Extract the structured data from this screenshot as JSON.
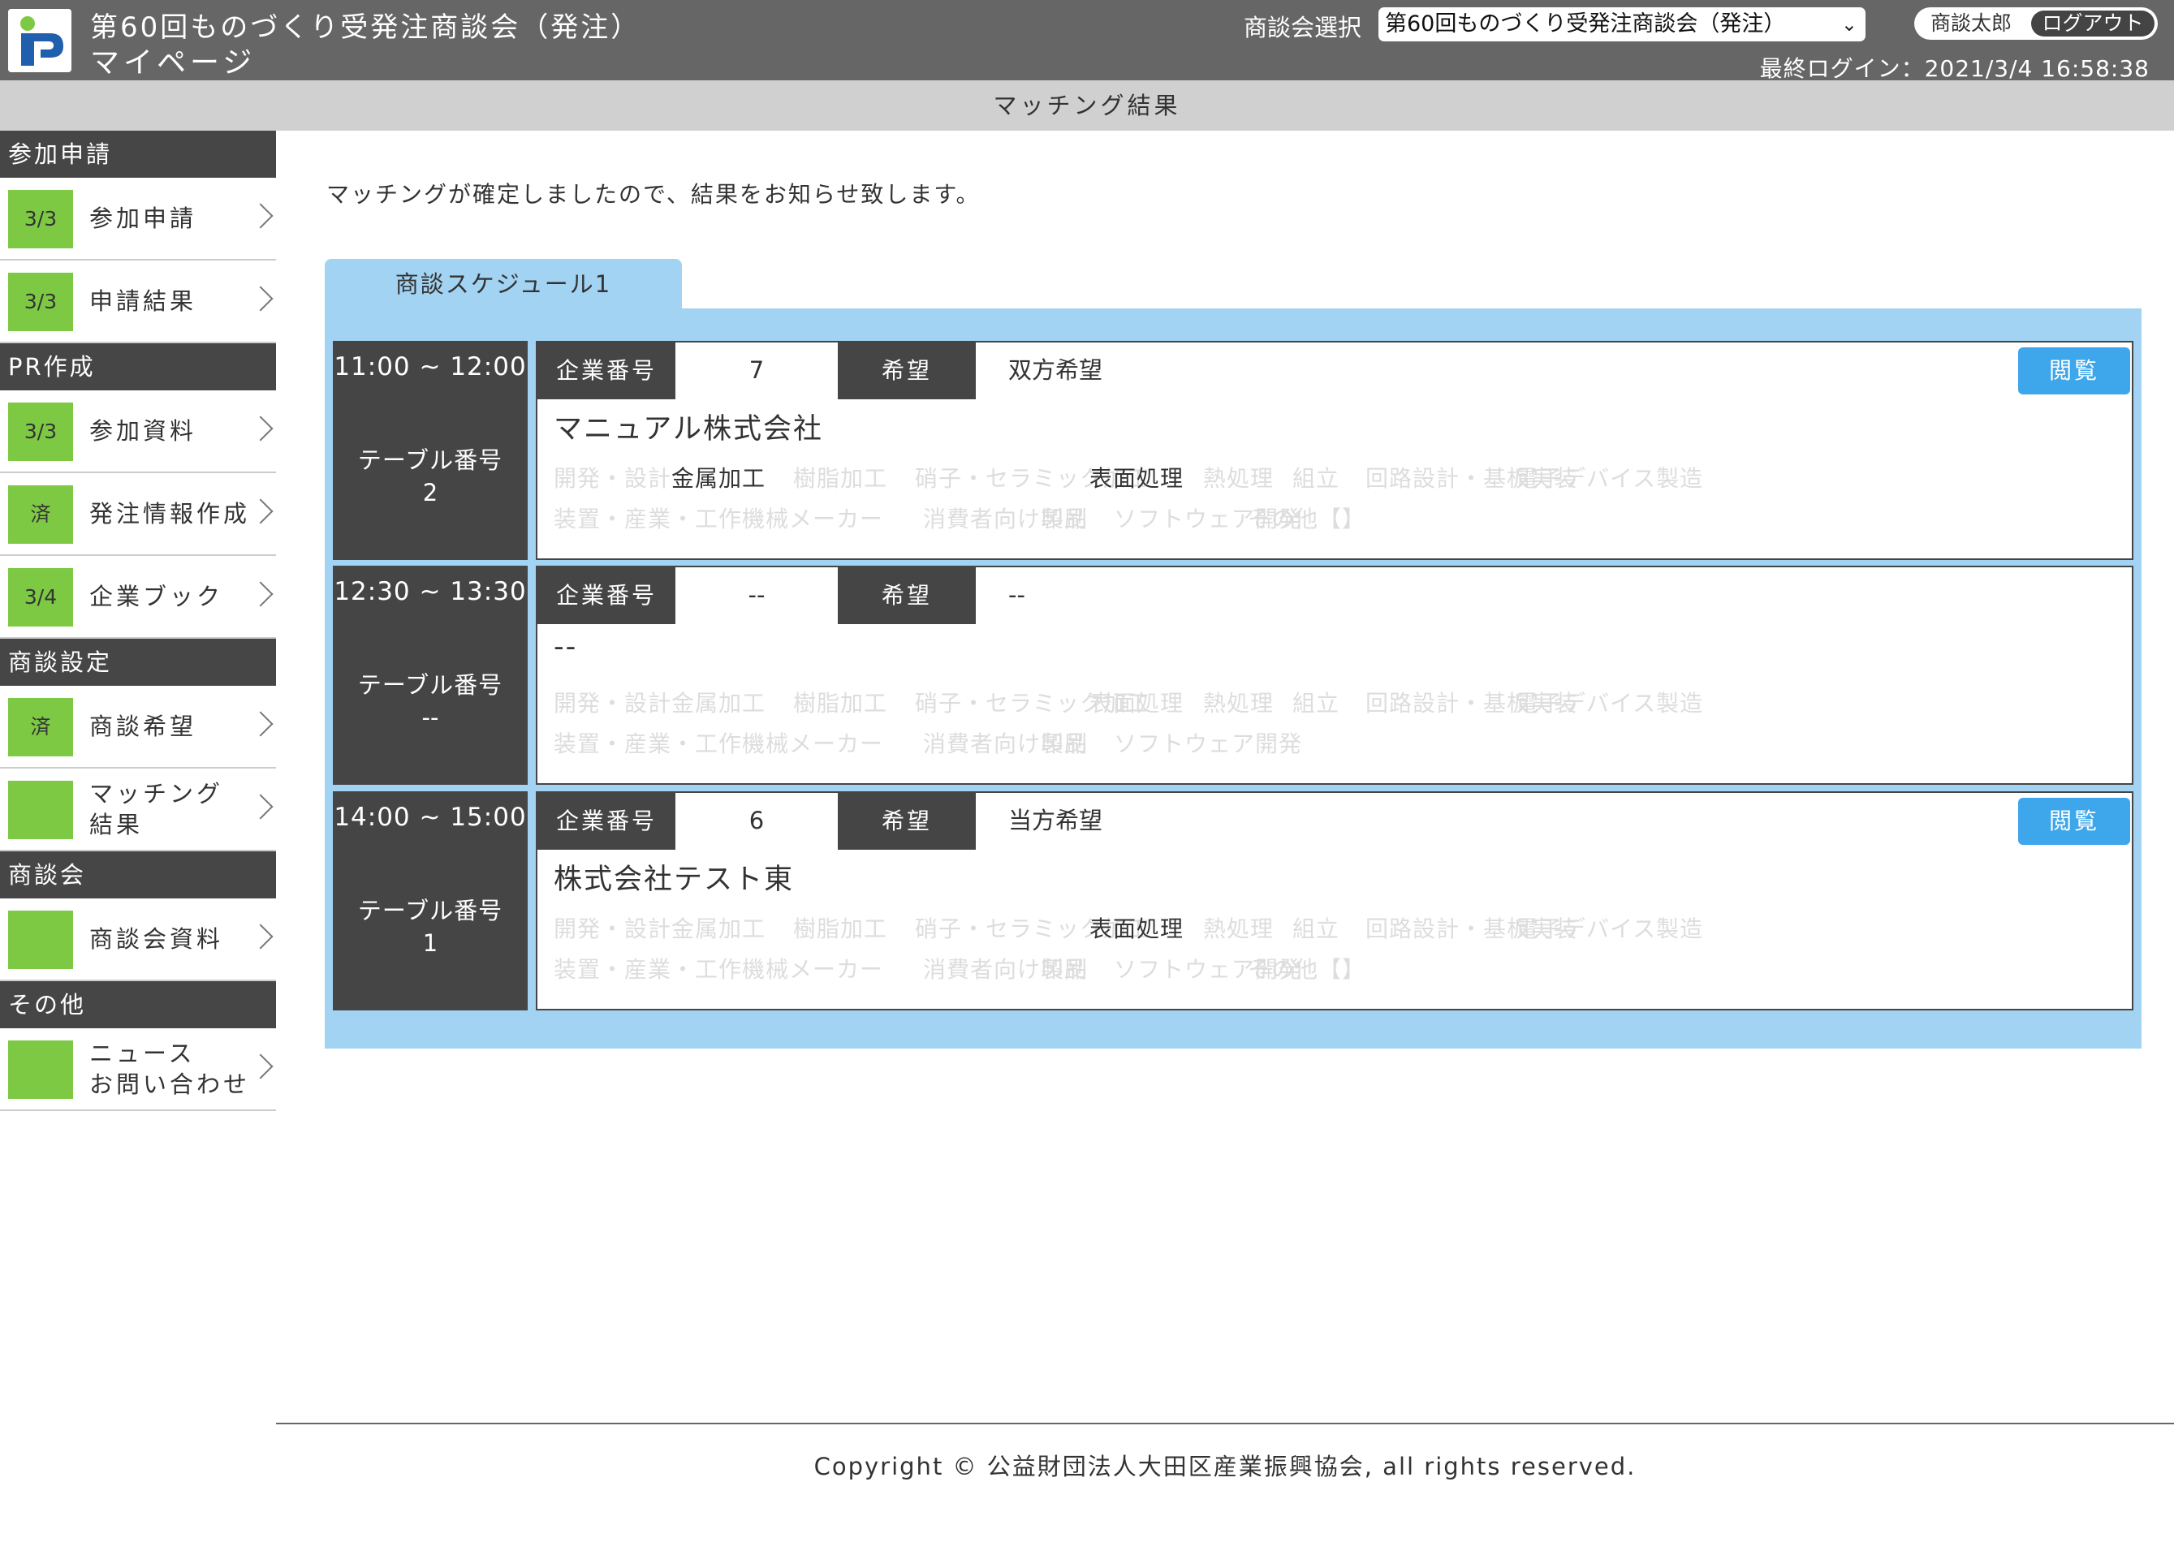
{
  "header": {
    "title": "第60回ものづくり受発注商談会（発注）",
    "subtitle": "マイページ",
    "select_label": "商談会選択",
    "select_value": "第60回ものづくり受発注商談会（発注）",
    "user_name": "商談太郎",
    "logout_label": "ログアウト",
    "last_login": "最終ログイン：2021/3/4 16:58:38",
    "brand_color": "#666666"
  },
  "page_title": "マッチング結果",
  "sidebar": {
    "sections": [
      {
        "title": "参加申請",
        "items": [
          {
            "badge": "3/3",
            "label": "参加申請"
          },
          {
            "badge": "3/3",
            "label": "申請結果"
          }
        ]
      },
      {
        "title": "PR作成",
        "items": [
          {
            "badge": "3/3",
            "label": "参加資料"
          },
          {
            "badge": "済",
            "label": "発注情報作成"
          },
          {
            "badge": "3/4",
            "label": "企業ブック"
          }
        ]
      },
      {
        "title": "商談設定",
        "items": [
          {
            "badge": "済",
            "label": "商談希望"
          },
          {
            "badge": "",
            "label": "マッチング\n結果"
          }
        ]
      },
      {
        "title": "商談会",
        "items": [
          {
            "badge": "",
            "label": "商談会資料"
          }
        ]
      },
      {
        "title": "その他",
        "items": [
          {
            "badge": "",
            "label": "ニュース\nお問い合わせ"
          }
        ]
      }
    ],
    "badge_color": "#7dc944"
  },
  "main": {
    "intro": "マッチングが確定しましたので、結果をお知らせ致します。",
    "tab_label": "商談スケジュール1",
    "company_no_label": "企業番号",
    "wish_label": "希望",
    "table_label": "テーブル番号",
    "view_label": "閲覧",
    "categories": [
      "開発・設計",
      "金属加工",
      "樹脂加工",
      "硝子・セラミック加工",
      "表面処理",
      "熱処理",
      "組立",
      "回路設計・基板実装",
      "電子デバイス製造",
      "装置・産業・工作機械メーカー",
      "消費者向け製品",
      "印刷",
      "ソフトウェア開発",
      "その他【】"
    ],
    "schedules": [
      {
        "time": "11:00 ~ 12:00",
        "table_no": "2",
        "company_no": "7",
        "wish": "双方希望",
        "company_name": "マニュアル株式会社",
        "active_tags": [
          1,
          4
        ],
        "has_view": true,
        "show_other": true
      },
      {
        "time": "12:30 ~ 13:30",
        "table_no": "--",
        "company_no": "--",
        "wish": "--",
        "company_name": "--",
        "active_tags": [],
        "has_view": false,
        "show_other": false
      },
      {
        "time": "14:00 ~ 15:00",
        "table_no": "1",
        "company_no": "6",
        "wish": "当方希望",
        "company_name": "株式会社テスト東",
        "active_tags": [
          4
        ],
        "has_view": true,
        "show_other": true
      }
    ],
    "accent_color": "#3ea6ea",
    "panel_color": "#a3d3f3"
  },
  "footer": {
    "copyright": "Copyright © 公益財団法人大田区産業振興協会, all rights reserved."
  }
}
